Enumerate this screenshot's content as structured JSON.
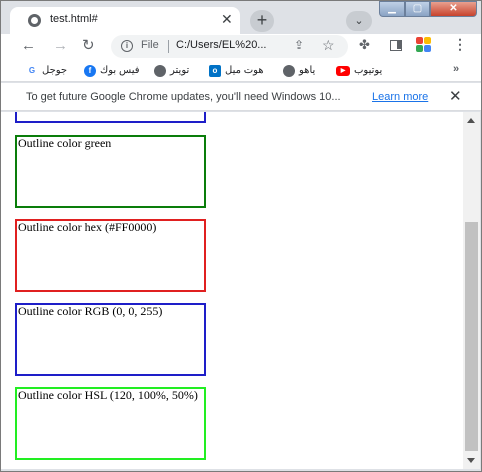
{
  "tab": {
    "title": "test.html#",
    "close_glyph": "✕",
    "new_tab_glyph": "+",
    "tab_search_glyph": "⌄"
  },
  "window_controls": {
    "minimize": "▁",
    "maximize": "▢",
    "close": "✕"
  },
  "toolbar": {
    "back_glyph": "←",
    "forward_glyph": "→",
    "reload_glyph": "↻",
    "file_chip": "File",
    "url": "C:/Users/EL%20...",
    "menu_glyph": "⋮"
  },
  "bookmarks": [
    {
      "label": "جوجل",
      "icon": "google-icon",
      "color": "#4285f4",
      "glyph": "G"
    },
    {
      "label": "فيس بوك",
      "icon": "facebook-icon",
      "color": "#1877f2",
      "glyph": "f"
    },
    {
      "label": "تويتر",
      "icon": "globe-icon",
      "color": "#5f6368",
      "glyph": ""
    },
    {
      "label": "هوت ميل",
      "icon": "outlook-icon",
      "color": "#0072c6",
      "glyph": "o"
    },
    {
      "label": "ياهو",
      "icon": "globe-icon",
      "color": "#5f6368",
      "glyph": ""
    },
    {
      "label": "يوتيوب",
      "icon": "youtube-icon",
      "color": "#ff0000",
      "glyph": "▶"
    }
  ],
  "bookmarks_more": "»",
  "infobar": {
    "message": "To get future Google Chrome updates, you'll need Windows 10...",
    "link": "Learn more",
    "close_glyph": "✕"
  },
  "page": {
    "boxes": [
      {
        "label": "",
        "outline_color": "#1e1ec8"
      },
      {
        "label": "Outline color green",
        "outline_color": "#0a7d0a"
      },
      {
        "label": "Outline color hex (#FF0000)",
        "outline_color": "#e02020"
      },
      {
        "label": "Outline color RGB (0, 0, 255)",
        "outline_color": "#1e1ec8"
      },
      {
        "label": "Outline color HSL (120, 100%, 50%)",
        "outline_color": "#22ee22"
      }
    ]
  },
  "colors": {
    "chrome_frame": "#dee1e6",
    "link_blue": "#1a73e8",
    "profile": [
      "#ea4335",
      "#fbbc05",
      "#34a853",
      "#4285f4"
    ]
  }
}
